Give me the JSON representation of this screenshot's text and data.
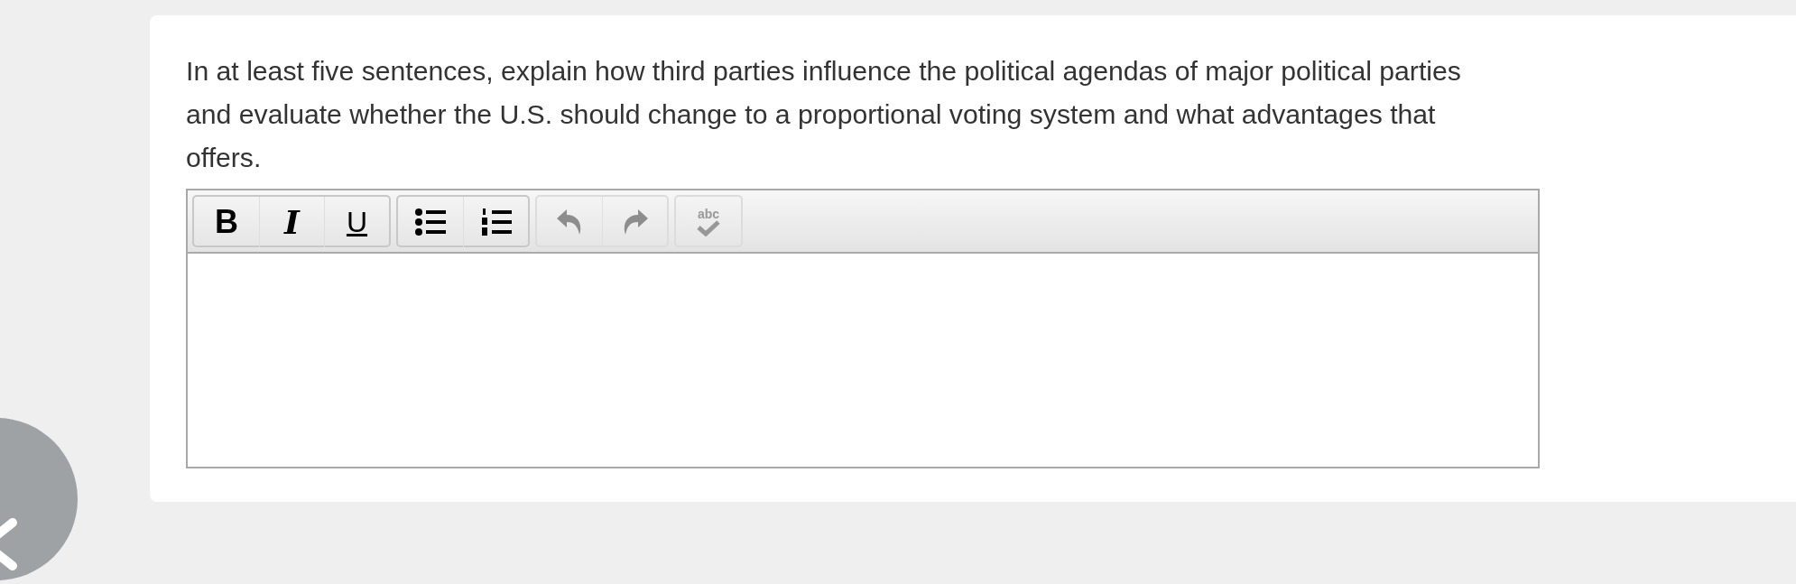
{
  "question": {
    "prompt": "In at least five sentences, explain how third parties influence the political agendas of major political parties and evaluate whether the U.S. should change to a proportional voting system and what advantages that offers."
  },
  "editor": {
    "toolbar": [
      {
        "buttons": [
          {
            "kind": "bold",
            "label": "B",
            "disabled": false
          },
          {
            "kind": "italic",
            "label": "I",
            "disabled": false
          },
          {
            "kind": "underline",
            "label": "U",
            "disabled": false
          }
        ]
      },
      {
        "buttons": [
          {
            "kind": "bullets",
            "disabled": false
          },
          {
            "kind": "numbers",
            "disabled": false
          }
        ]
      },
      {
        "buttons": [
          {
            "kind": "undo",
            "disabled": true
          },
          {
            "kind": "redo",
            "disabled": true
          }
        ]
      },
      {
        "buttons": [
          {
            "kind": "spellcheck",
            "label": "abc",
            "disabled": true
          }
        ]
      }
    ]
  },
  "back_button": {
    "kind": "close"
  }
}
